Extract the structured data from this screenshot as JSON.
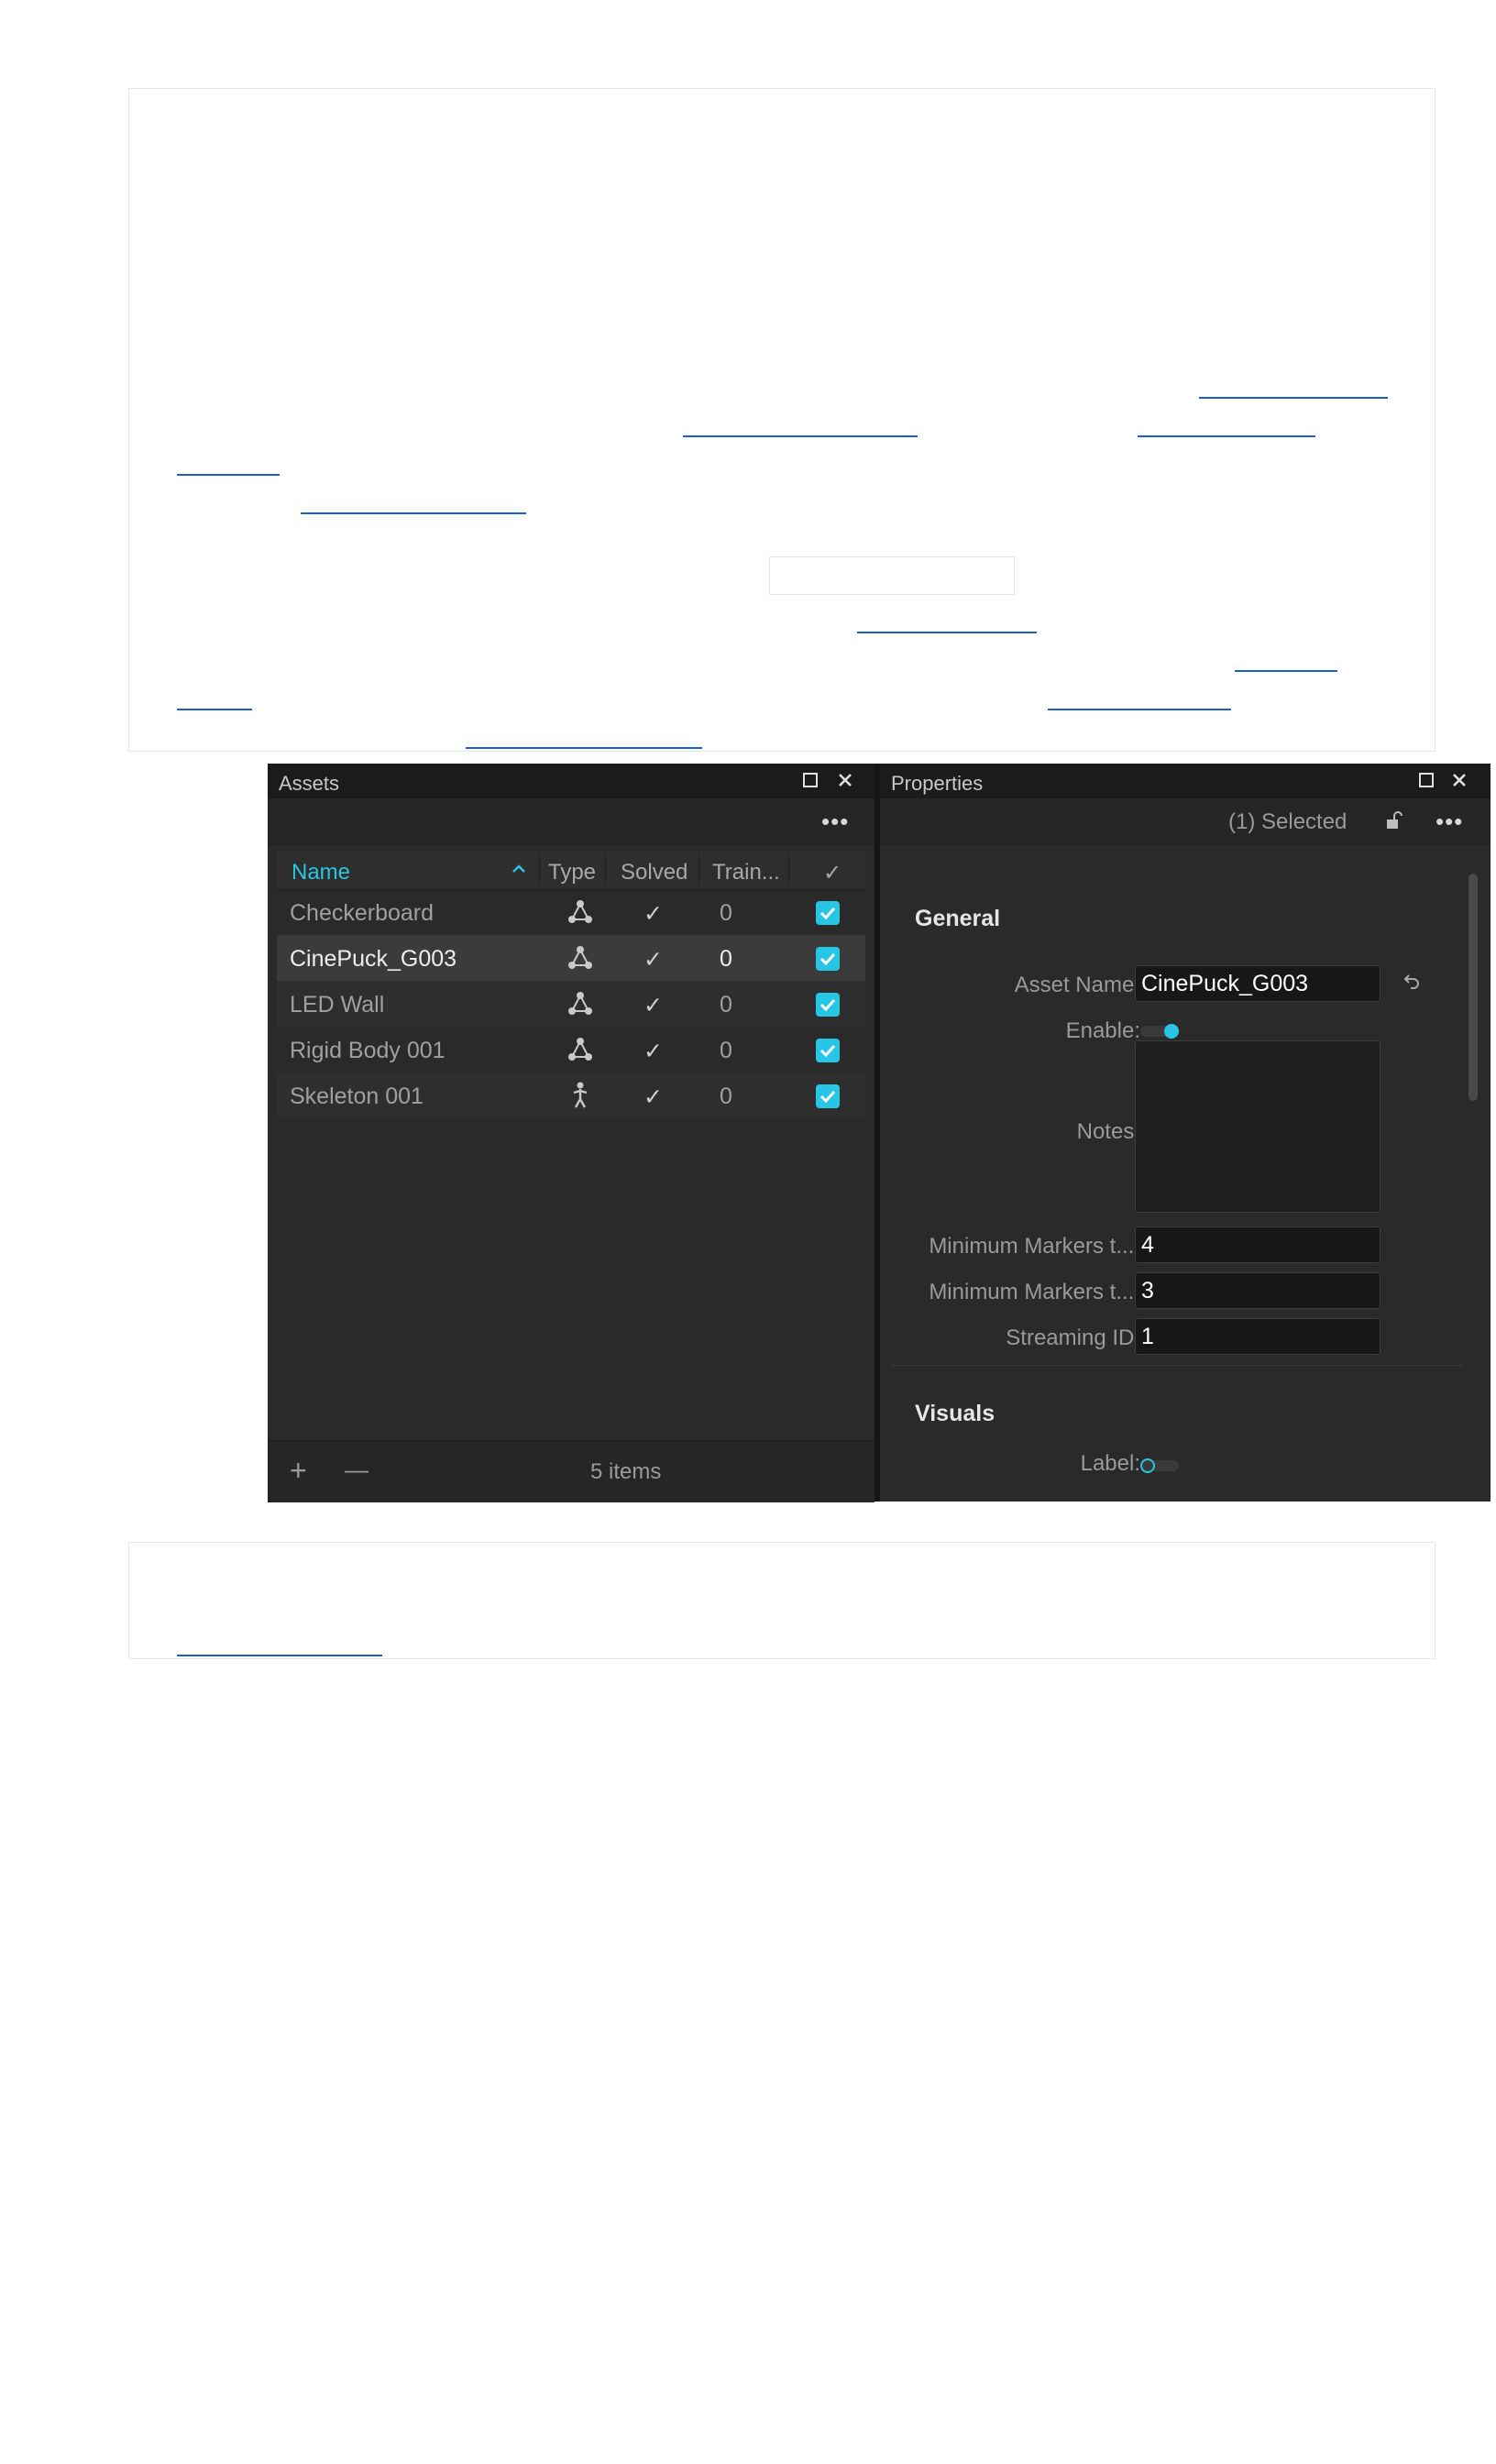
{
  "assets_panel": {
    "title": "Assets",
    "columns": [
      "Name",
      "Type",
      "Solved",
      "Train...",
      "✓"
    ],
    "rows": [
      {
        "name": "Checkerboard",
        "type": "rigid-body-icon",
        "solved": "✓",
        "train": "0",
        "enabled": true
      },
      {
        "name": "CinePuck_G003",
        "type": "rigid-body-icon",
        "solved": "✓",
        "train": "0",
        "enabled": true
      },
      {
        "name": "LED Wall",
        "type": "rigid-body-icon",
        "solved": "✓",
        "train": "0",
        "enabled": true
      },
      {
        "name": "Rigid Body 001",
        "type": "rigid-body-icon",
        "solved": "✓",
        "train": "0",
        "enabled": true
      },
      {
        "name": "Skeleton 001",
        "type": "skeleton-icon",
        "solved": "✓",
        "train": "0",
        "enabled": true
      }
    ],
    "item_count": "5 items",
    "add_label": "+",
    "remove_label": "—",
    "dots": "•••"
  },
  "properties_panel": {
    "title": "Properties",
    "selected": "(1) Selected",
    "dots": "•••",
    "general_title": "General",
    "asset_name_label": "Asset Name:",
    "asset_name_value": "CinePuck_G003",
    "enable_label": "Enable:",
    "notes_label": "Notes:",
    "min_markers_1_label": "Minimum Markers t...:",
    "min_markers_1_value": "4",
    "min_markers_2_label": "Minimum Markers t...:",
    "min_markers_2_value": "3",
    "streaming_id_label": "Streaming ID:",
    "streaming_id_value": "1",
    "visuals_title": "Visuals",
    "label_label": "Label:"
  },
  "colors": {
    "accent": "#27c6e5",
    "panel_bg": "#2a2a2a",
    "link": "#1a5fd1"
  }
}
